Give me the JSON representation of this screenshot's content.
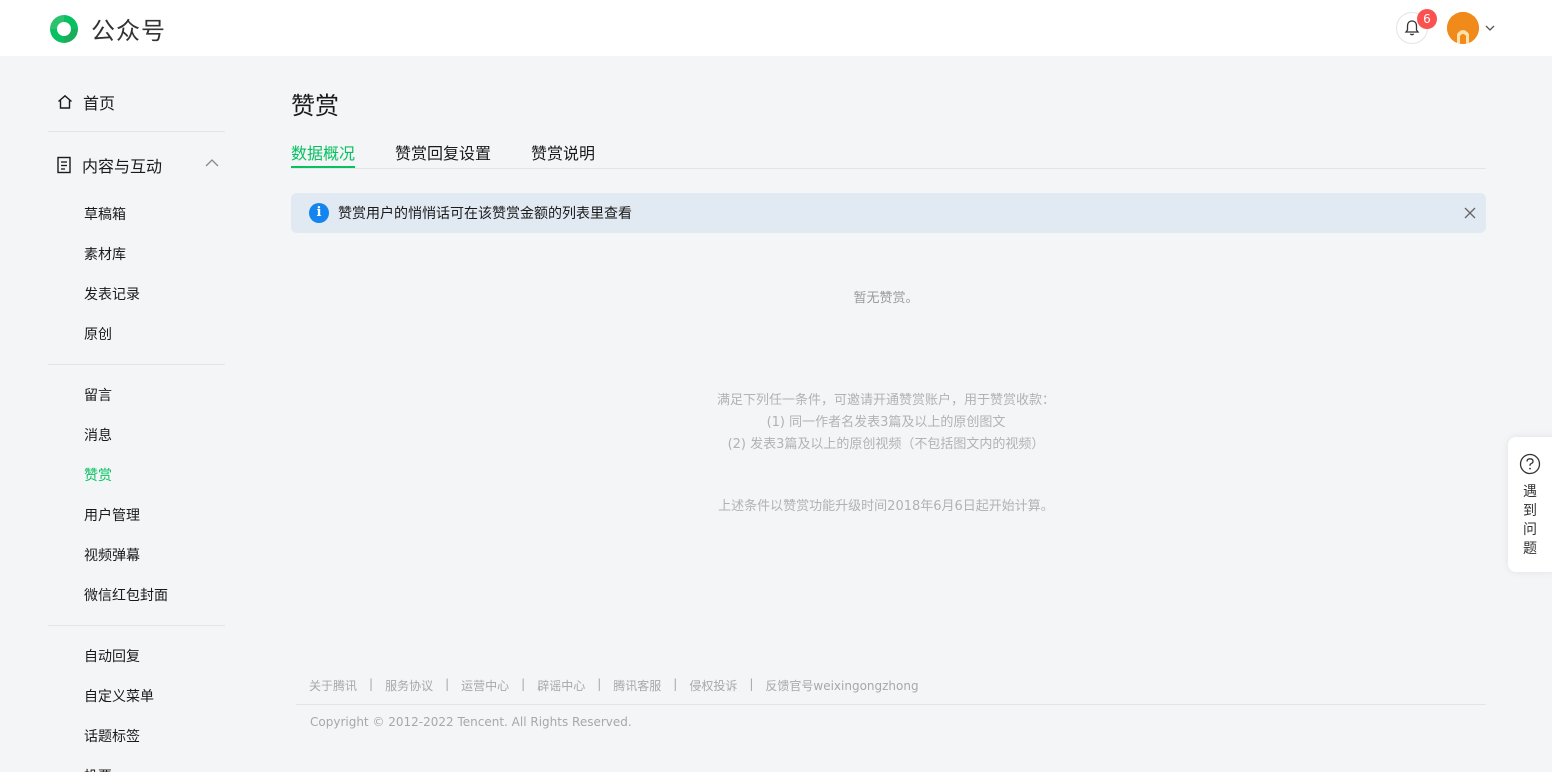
{
  "header": {
    "app_title": "公众号",
    "notification_count": "6"
  },
  "sidebar": {
    "home_label": "首页",
    "group_label": "内容与互动",
    "items": [
      {
        "label": "草稿箱"
      },
      {
        "label": "素材库"
      },
      {
        "label": "发表记录"
      },
      {
        "label": "原创"
      },
      {
        "label": "留言"
      },
      {
        "label": "消息"
      },
      {
        "label": "赞赏"
      },
      {
        "label": "用户管理"
      },
      {
        "label": "视频弹幕"
      },
      {
        "label": "微信红包封面"
      },
      {
        "label": "自动回复"
      },
      {
        "label": "自定义菜单"
      },
      {
        "label": "话题标签"
      },
      {
        "label": "投票"
      }
    ],
    "active_item": "赞赏"
  },
  "main": {
    "title": "赞赏",
    "tabs": [
      {
        "label": "数据概况"
      },
      {
        "label": "赞赏回复设置"
      },
      {
        "label": "赞赏说明"
      }
    ],
    "notice": "赞赏用户的悄悄话可在该赞赏金额的列表里查看",
    "empty_text": "暂无赞赏。",
    "conditions": {
      "intro": "满足下列任一条件，可邀请开通赞赏账户，用于赞赏收款：",
      "item1": "(1) 同一作者名发表3篇及以上的原创图文",
      "item2": "(2) 发表3篇及以上的原创视频（不包括图文内的视频）",
      "note": "上述条件以赞赏功能升级时间2018年6月6日起开始计算。"
    }
  },
  "footer": {
    "links": [
      "关于腾讯",
      "服务协议",
      "运营中心",
      "辟谣中心",
      "腾讯客服",
      "侵权投诉",
      "反馈官号weixingongzhong"
    ],
    "separator": "|",
    "copyright": "Copyright © 2012-2022 Tencent. All Rights Reserved."
  },
  "help": {
    "label": "遇到问题"
  },
  "colors": {
    "accent": "#07c160",
    "info": "#1485ee",
    "badge": "#fa5151",
    "background": "#f4f5f7"
  }
}
